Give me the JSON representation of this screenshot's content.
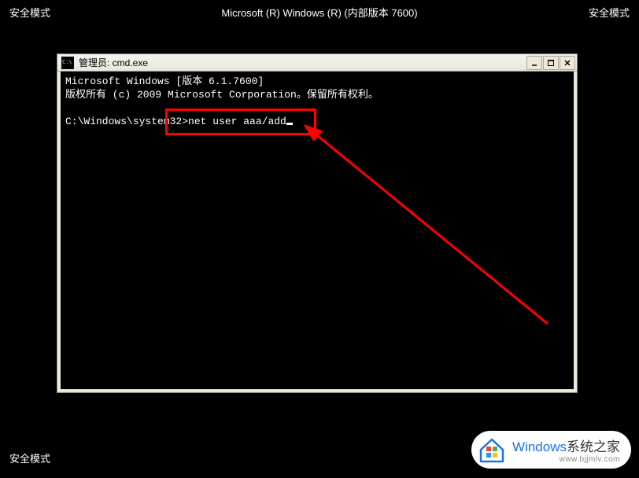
{
  "desktop": {
    "safe_mode": "安全模式",
    "header_center": "Microsoft (R) Windows (R) (内部版本 7600)"
  },
  "cmd": {
    "title": "管理员: cmd.exe",
    "line1": "Microsoft Windows [版本 6.1.7600]",
    "line2": "版权所有 (c) 2009 Microsoft Corporation。保留所有权利。",
    "prompt": "C:\\Windows\\system32>",
    "command": "net user aaa/add"
  },
  "watermark": {
    "brand_en": "Windows",
    "brand_cn": "系统之家",
    "url": "www.bjjmlv.com"
  }
}
